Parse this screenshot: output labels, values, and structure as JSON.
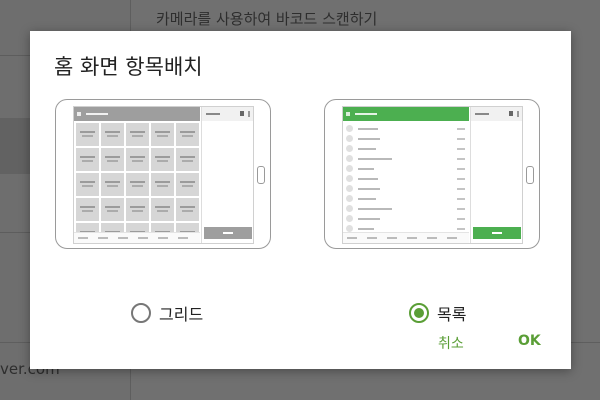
{
  "background": {
    "title": "카메라를 사용하여 바코드 스캔하기",
    "email_fragment": "ver.com"
  },
  "dialog": {
    "title": "홈 화면 항목배치",
    "options": [
      {
        "label": "그리드",
        "selected": false,
        "preview": "grid",
        "accent": "#9e9e9e"
      },
      {
        "label": "목록",
        "selected": true,
        "preview": "list",
        "accent": "#4caf50"
      }
    ],
    "cancel_label": "취소",
    "ok_label": "OK",
    "accent_color": "#5a9e36"
  }
}
